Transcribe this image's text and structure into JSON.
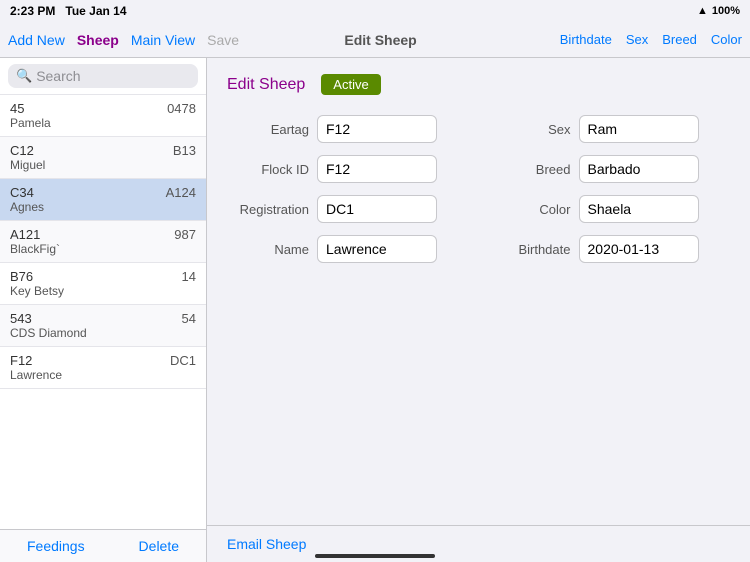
{
  "statusBar": {
    "time": "2:23 PM",
    "date": "Tue Jan 14",
    "battery": "100%",
    "batteryLabel": "100%"
  },
  "navBar": {
    "addNew": "Add New",
    "sheep": "Sheep",
    "mainView": "Main View",
    "save": "Save",
    "editSheep": "Edit Sheep",
    "birthdate": "Birthdate",
    "sex": "Sex",
    "breed": "Breed",
    "color": "Color"
  },
  "search": {
    "placeholder": "Search"
  },
  "sheepList": [
    {
      "id": "45",
      "name": "Pamela",
      "tag": "0478"
    },
    {
      "id": "C12",
      "name": "Miguel",
      "tag": "B13"
    },
    {
      "id": "C34",
      "name": "Agnes",
      "tag": "A124",
      "selected": true
    },
    {
      "id": "A121",
      "name": "BlackFig`",
      "tag": "987"
    },
    {
      "id": "B76",
      "name": "Key Betsy",
      "tag": "14"
    },
    {
      "id": "543",
      "name": "CDS Diamond",
      "tag": "54"
    },
    {
      "id": "F12",
      "name": "Lawrence",
      "tag": "DC1"
    }
  ],
  "sidebarFooter": {
    "feedings": "Feedings",
    "delete": "Delete"
  },
  "editForm": {
    "title": "Edit Sheep",
    "statusBadge": "Active",
    "eartag": {
      "label": "Eartag",
      "value": "F12"
    },
    "sex": {
      "label": "Sex",
      "value": "Ram"
    },
    "flockId": {
      "label": "Flock ID",
      "value": "F12"
    },
    "breed": {
      "label": "Breed",
      "value": "Barbado"
    },
    "registration": {
      "label": "Registration",
      "value": "DC1"
    },
    "color": {
      "label": "Color",
      "value": "Shaela"
    },
    "name": {
      "label": "Name",
      "value": "Lawrence"
    },
    "birthdate": {
      "label": "Birthdate",
      "value": "2020-01-13"
    }
  },
  "contentFooter": {
    "emailSheep": "Email Sheep"
  },
  "icons": {
    "search": "🔍",
    "wifi": "wifi",
    "battery": "battery"
  }
}
